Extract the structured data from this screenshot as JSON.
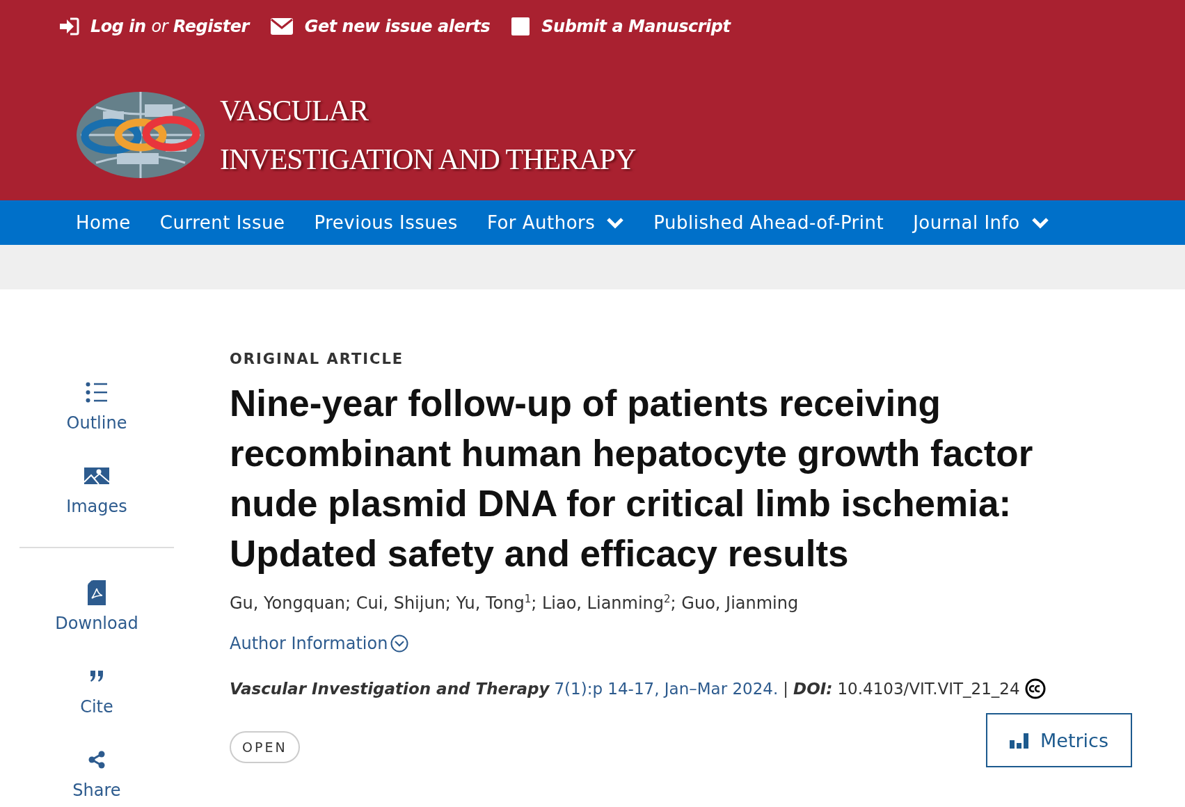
{
  "top_bar": {
    "login": "Log in",
    "or": "or",
    "register": "Register",
    "alerts": "Get new issue alerts",
    "submit": "Submit a Manuscript"
  },
  "logo": {
    "line1": "VASCULAR",
    "line2": "INVESTIGATION AND THERAPY"
  },
  "nav": [
    {
      "label": "Home",
      "dropdown": false
    },
    {
      "label": "Current Issue",
      "dropdown": false
    },
    {
      "label": "Previous Issues",
      "dropdown": false
    },
    {
      "label": "For Authors",
      "dropdown": true
    },
    {
      "label": "Published Ahead-of-Print",
      "dropdown": false
    },
    {
      "label": "Journal Info",
      "dropdown": true
    }
  ],
  "sidebar": {
    "groups": [
      [
        {
          "kind": "outline",
          "label": "Outline"
        },
        {
          "kind": "images",
          "label": "Images"
        }
      ],
      [
        {
          "kind": "download",
          "label": "Download"
        },
        {
          "kind": "cite",
          "label": "Cite"
        },
        {
          "kind": "share",
          "label": "Share"
        }
      ]
    ]
  },
  "article": {
    "type": "ORIGINAL ARTICLE",
    "title": "Nine-year follow-up of patients receiving recombinant human hepatocyte growth factor nude plasmid DNA for critical limb ischemia: Updated safety and efficacy results",
    "authors": "Gu, Yongquan; Cui, Shijun; Yu, Tong$^{1}$; Liao, Lianming$^{2}$; Guo, Jianming",
    "author_info": "Author Information",
    "citation": {
      "journal": "Vascular Investigation and Therapy",
      "issue": "7(1):p 14-17, Jan–Mar 2024.",
      "separator": "|",
      "doi_label": "DOI:",
      "doi": "10.4103/VIT.VIT_21_24"
    },
    "access_badge": "OPEN",
    "metrics_button": "Metrics"
  }
}
